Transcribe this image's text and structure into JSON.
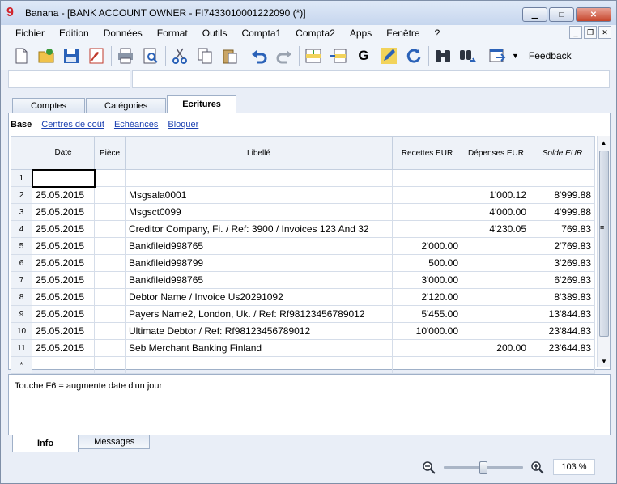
{
  "window": {
    "title": "Banana - [BANK ACCOUNT OWNER - FI7433010001222090 (*)]",
    "logo": "9"
  },
  "menu": [
    "Fichier",
    "Edition",
    "Données",
    "Format",
    "Outils",
    "Compta1",
    "Compta2",
    "Apps",
    "Fenêtre",
    "?"
  ],
  "toolbar": {
    "icons": [
      "new-file-icon",
      "open-folder-icon",
      "save-icon",
      "pdf-icon",
      "print-icon",
      "print-preview-icon",
      "cut-icon",
      "copy-icon",
      "paste-icon",
      "undo-icon",
      "redo-icon",
      "insert-row-icon",
      "delete-row-icon",
      "go-to-icon",
      "edit-pencil-icon",
      "recheck-icon",
      "find-binoculars-icon",
      "find-replace-icon",
      "export-window-icon"
    ],
    "feedback_label": "Feedback",
    "go_label": "G"
  },
  "tabs": [
    "Comptes",
    "Catégories",
    "Ecritures"
  ],
  "subviews": [
    "Base",
    "Centres de coût",
    "Echéances",
    "Bloquer"
  ],
  "table": {
    "columns": [
      "Date",
      "Pièce",
      "Libellé",
      "Recettes EUR",
      "Dépenses EUR",
      "Solde EUR"
    ],
    "rows": [
      {
        "n": "1",
        "date": "",
        "piece": "",
        "libelle": "",
        "recettes": "",
        "depenses": "",
        "solde": ""
      },
      {
        "n": "2",
        "date": "25.05.2015",
        "piece": "",
        "libelle": "Msgsala0001",
        "recettes": "",
        "depenses": "1'000.12",
        "solde": "8'999.88"
      },
      {
        "n": "3",
        "date": "25.05.2015",
        "piece": "",
        "libelle": "Msgsct0099",
        "recettes": "",
        "depenses": "4'000.00",
        "solde": "4'999.88"
      },
      {
        "n": "4",
        "date": "25.05.2015",
        "piece": "",
        "libelle": "Creditor Company, Fi.  / Ref: 3900 /  Invoices 123 And 32",
        "recettes": "",
        "depenses": "4'230.05",
        "solde": "769.83"
      },
      {
        "n": "5",
        "date": "25.05.2015",
        "piece": "",
        "libelle": "Bankfileid998765",
        "recettes": "2'000.00",
        "depenses": "",
        "solde": "2'769.83"
      },
      {
        "n": "6",
        "date": "25.05.2015",
        "piece": "",
        "libelle": "Bankfileid998799",
        "recettes": "500.00",
        "depenses": "",
        "solde": "3'269.83"
      },
      {
        "n": "7",
        "date": "25.05.2015",
        "piece": "",
        "libelle": "Bankfileid998765",
        "recettes": "3'000.00",
        "depenses": "",
        "solde": "6'269.83"
      },
      {
        "n": "8",
        "date": "25.05.2015",
        "piece": "",
        "libelle": "Debtor Name /  Invoice Us20291092",
        "recettes": "2'120.00",
        "depenses": "",
        "solde": "8'389.83"
      },
      {
        "n": "9",
        "date": "25.05.2015",
        "piece": "",
        "libelle": "Payers Name2, London, Uk.  / Ref: Rf98123456789012",
        "recettes": "5'455.00",
        "depenses": "",
        "solde": "13'844.83"
      },
      {
        "n": "10",
        "date": "25.05.2015",
        "piece": "",
        "libelle": "Ultimate Debtor / Ref: Rf98123456789012",
        "recettes": "10'000.00",
        "depenses": "",
        "solde": "23'844.83"
      },
      {
        "n": "11",
        "date": "25.05.2015",
        "piece": "",
        "libelle": "Seb Merchant Banking Finland",
        "recettes": "",
        "depenses": "200.00",
        "solde": "23'644.83"
      },
      {
        "n": "*",
        "date": "",
        "piece": "",
        "libelle": "",
        "recettes": "",
        "depenses": "",
        "solde": ""
      }
    ]
  },
  "info": {
    "text": "Touche F6 = augmente date d'un jour"
  },
  "bottom_tabs": [
    "Info",
    "Messages"
  ],
  "zoom": {
    "value": "103 %",
    "level_percent": 103
  }
}
